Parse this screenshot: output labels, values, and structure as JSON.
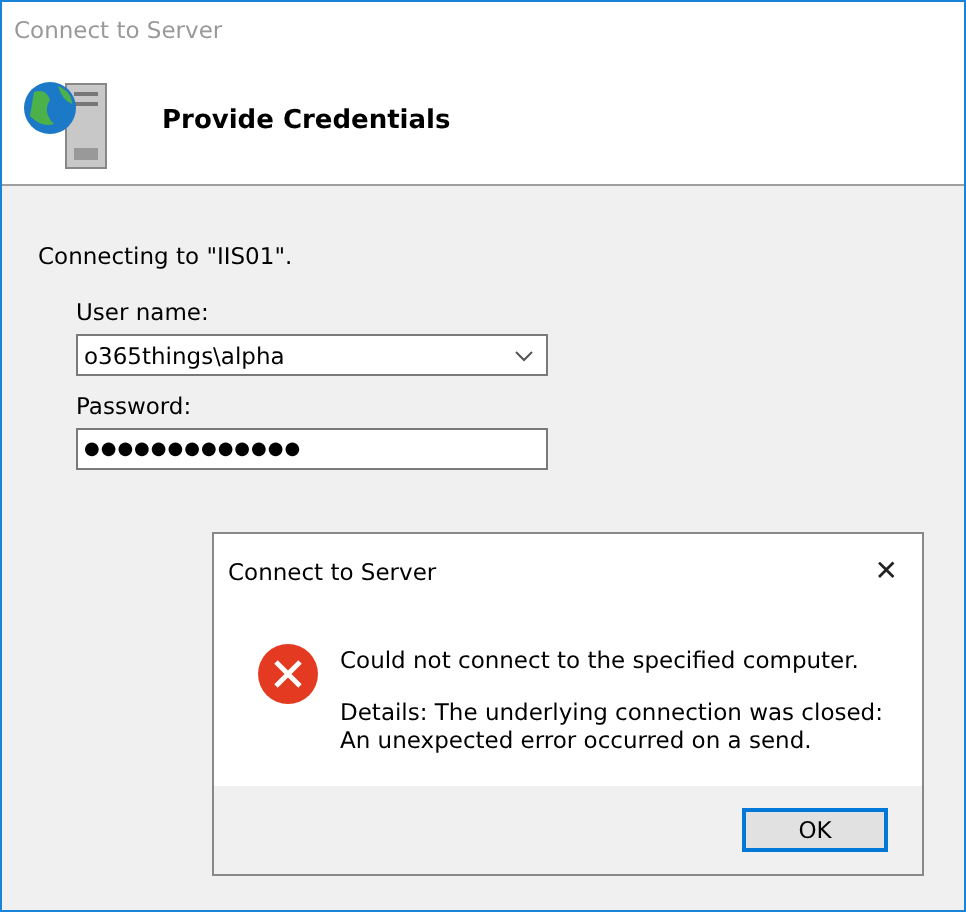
{
  "window": {
    "title": "Connect to Server"
  },
  "header": {
    "title": "Provide Credentials"
  },
  "connecting_text": "Connecting to \"IIS01\".",
  "user_name": {
    "label": "User name:",
    "value": "o365things\\alpha"
  },
  "password": {
    "label": "Password:",
    "value": "●●●●●●●●●●●●●"
  },
  "dialog": {
    "title": "Connect to Server",
    "close": "✕",
    "message": "Could not connect to the specified computer.",
    "details": "Details: The underlying connection was closed: An unexpected error occurred on a send.",
    "buttons": [
      "OK"
    ]
  }
}
